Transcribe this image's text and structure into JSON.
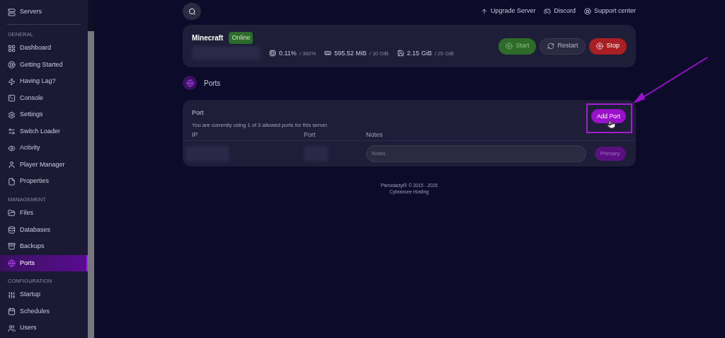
{
  "sidebar": {
    "top_item": "Servers",
    "sections": [
      {
        "title": "GENERAL",
        "items": [
          {
            "label": "Dashboard",
            "selected": false
          },
          {
            "label": "Getting Started",
            "selected": false
          },
          {
            "label": "Having Lag?",
            "selected": false
          },
          {
            "label": "Console",
            "selected": false
          },
          {
            "label": "Settings",
            "selected": false
          },
          {
            "label": "Switch Loader",
            "selected": false
          },
          {
            "label": "Activity",
            "selected": false
          },
          {
            "label": "Player Manager",
            "selected": false
          },
          {
            "label": "Properties",
            "selected": false
          }
        ]
      },
      {
        "title": "MANAGEMENT",
        "items": [
          {
            "label": "Files",
            "selected": false
          },
          {
            "label": "Databases",
            "selected": false
          },
          {
            "label": "Backups",
            "selected": false
          },
          {
            "label": "Ports",
            "selected": true
          }
        ]
      },
      {
        "title": "CONFIGURATION",
        "items": [
          {
            "label": "Startup",
            "selected": false
          },
          {
            "label": "Schedules",
            "selected": false
          },
          {
            "label": "Users",
            "selected": false
          }
        ]
      }
    ]
  },
  "top_links": [
    "Upgrade Server",
    "Discord",
    "Support center"
  ],
  "server": {
    "name": "Minecraft",
    "status": "Online",
    "stats": [
      {
        "value": "0.11%",
        "limit": "/ 300%"
      },
      {
        "value": "595.52 MiB",
        "limit": "/ 10 GiB"
      },
      {
        "value": "2.15 GiB",
        "limit": "/ 20 GiB"
      }
    ],
    "buttons": [
      {
        "kind": "start",
        "label": "Start"
      },
      {
        "kind": "restart",
        "label": "Restart"
      },
      {
        "kind": "stop",
        "label": "Stop"
      }
    ]
  },
  "page_title": "Ports",
  "ports": {
    "title": "Port",
    "description": "You are currently using 1 of 3 allowed ports for this server.",
    "add_button": "Add Port",
    "columns": [
      "IP",
      "Port",
      "Notes"
    ],
    "rows": [
      {
        "notes_placeholder": "Notes",
        "primary_button": "Primary"
      }
    ]
  },
  "footer": [
    "Pterodactyl® © 2015 - 2025",
    "Cybrancee Hosting"
  ]
}
